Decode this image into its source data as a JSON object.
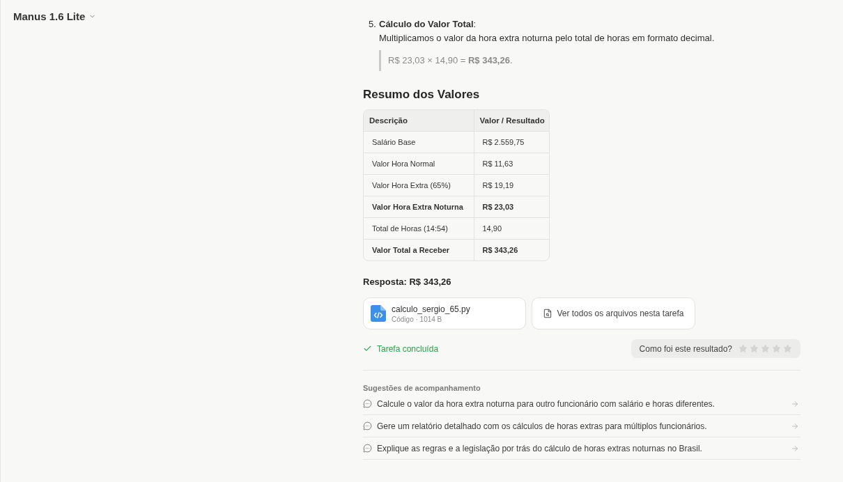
{
  "header": {
    "model_label": "Manus 1.6 Lite"
  },
  "steps": [
    {
      "number": "5.",
      "title": "**Cálculo do Valor Total**:",
      "text": "Multiplicamos o valor da hora extra noturna pelo total de horas em formato decimal.",
      "formula": "R$ 23,03 × 14,90 = **R$ 343,26**."
    }
  ],
  "summary": {
    "heading": "Resumo dos Valores",
    "columns": [
      "Descrição",
      "Valor / Resultado"
    ],
    "rows": [
      {
        "cells": [
          "Salário Base",
          "R$ 2.559,75"
        ],
        "emphasized": false
      },
      {
        "cells": [
          "Valor Hora Normal",
          "R$ 11,63"
        ],
        "emphasized": false
      },
      {
        "cells": [
          "Valor Hora Extra (65%)",
          "R$ 19,19"
        ],
        "emphasized": false
      },
      {
        "cells": [
          "Valor Hora Extra Noturna",
          "R$ 23,03"
        ],
        "emphasized": true
      },
      {
        "cells": [
          "Total de Horas (14:54)",
          "14,90"
        ],
        "emphasized": false
      },
      {
        "cells": [
          "Valor Total a Receber",
          "R$ 343,26"
        ],
        "emphasized": true
      }
    ]
  },
  "answer": "Resposta: R$ 343,26",
  "files": [
    {
      "kind": "file",
      "name": "calculo_sergio_65.py",
      "meta": "Código · 1014 B"
    },
    {
      "kind": "link",
      "label": "Ver todos os arquivos nesta tarefa"
    }
  ],
  "status": {
    "label": "Tarefa concluída"
  },
  "rating": {
    "prompt": "Como foi este resultado?",
    "stars": 0
  },
  "suggestions": {
    "heading": "Sugestões de acompanhamento",
    "items": [
      "Calcule o valor da hora extra noturna para outro funcionário com salário e horas diferentes.",
      "Gere um relatório detalhado com os cálculos de horas extras para múltiplos funcionários.",
      "Explique as regras e a legislação por trás do cálculo de horas extras noturnas no Brasil."
    ]
  }
}
